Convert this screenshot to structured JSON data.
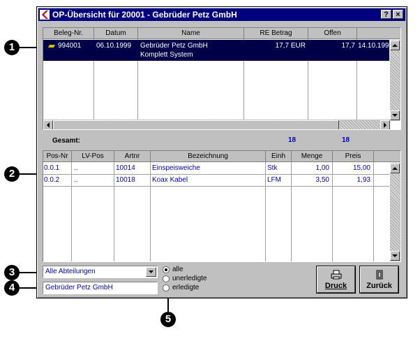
{
  "window": {
    "title": "OP-Übersicht für 20001 -  Gebrüder Petz GmbH",
    "help_btn": "?",
    "close_btn": "×"
  },
  "upper_table": {
    "columns": [
      "Beleg-Nr.",
      "Datum",
      "Name",
      "RE Betrag",
      "Offen",
      ""
    ],
    "rows": [
      {
        "beleg": "994001",
        "datum": "06.10.1999",
        "name_line1": "Gebrüder Petz GmbH",
        "name_line2": "Komplett System",
        "re_betrag": "17,7 EUR",
        "offen": "17,7",
        "due": "14.10.199"
      }
    ]
  },
  "totals": {
    "label": "Gesamt:",
    "re_total": "18",
    "offen_total": "18"
  },
  "lower_table": {
    "columns": [
      "Pos-Nr",
      "LV-Pos",
      "Artnr",
      "Bezeichnung",
      "Einh",
      "Menge",
      "Preis",
      ""
    ],
    "rows": [
      {
        "pos": "0.0.1",
        "lv": "..",
        "art": "10014",
        "bez": "Einspeisweiche",
        "einh": "Stk",
        "menge": "1,00",
        "preis": "15,00"
      },
      {
        "pos": "0.0.2",
        "lv": "..",
        "art": "10018",
        "bez": "Koax Kabel",
        "einh": "LFM",
        "menge": "3,50",
        "preis": "1,93"
      }
    ]
  },
  "department_select": {
    "value": "Alle Abteilungen"
  },
  "customer_field": {
    "value": "Gebrüder Petz GmbH"
  },
  "filter": {
    "options": [
      "alle",
      "unerledigte",
      "erledigte"
    ],
    "selected": "alle"
  },
  "buttons": {
    "print": "Druck",
    "back": "Zurück"
  },
  "callouts": [
    "1",
    "2",
    "3",
    "4",
    "5"
  ],
  "colors": {
    "title_bar": "#000080",
    "selection": "#000048",
    "data_blue": "#0000cc",
    "dialog_bg": "#c0c0c0"
  }
}
